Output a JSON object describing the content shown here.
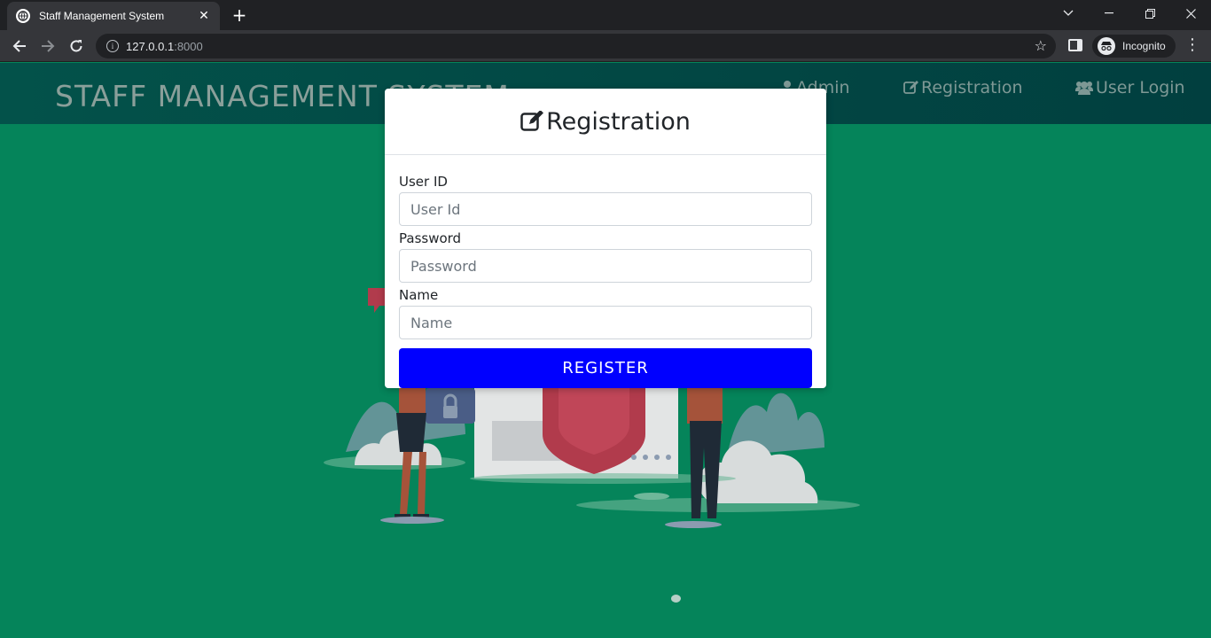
{
  "browser": {
    "tab_title": "Staff Management System",
    "tab_close": "✕",
    "new_tab": "+",
    "url_host": "127.0.0.1",
    "url_port": ":8000",
    "incognito_label": "Incognito"
  },
  "header": {
    "brand": "STAFF MANAGEMENT SYSTEM",
    "nav": [
      {
        "label": "Admin",
        "icon": "user-icon"
      },
      {
        "label": "Registration",
        "icon": "edit-icon"
      },
      {
        "label": "User Login",
        "icon": "users-icon"
      }
    ]
  },
  "modal": {
    "title": "Registration",
    "fields": [
      {
        "label": "User ID",
        "placeholder": "User Id"
      },
      {
        "label": "Password",
        "placeholder": "Password"
      },
      {
        "label": "Name",
        "placeholder": "Name"
      }
    ],
    "submit_label": "REGISTER"
  },
  "colors": {
    "page_bg": "#05845a",
    "header_bg": "#013f3f",
    "button": "#0000ff"
  }
}
